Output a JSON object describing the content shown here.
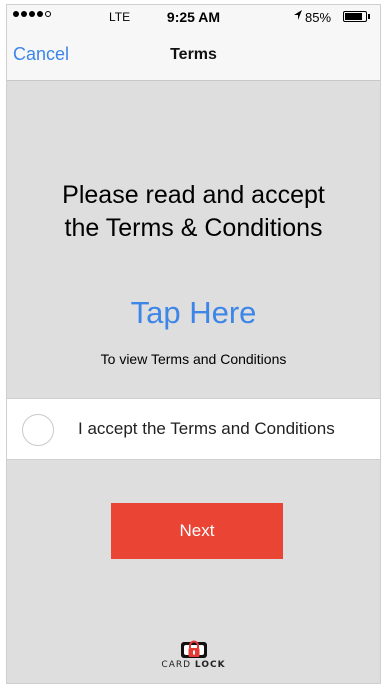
{
  "status_bar": {
    "carrier": "LTE",
    "time": "9:25 AM",
    "battery_percent": "85%",
    "battery_level": 0.85,
    "location_icon": "location-arrow-icon"
  },
  "nav": {
    "cancel_label": "Cancel",
    "title": "Terms"
  },
  "main": {
    "heading_line1": "Please read and accept",
    "heading_line2": "the Terms & Conditions",
    "tap_here": "Tap Here",
    "view_terms": "To view Terms and Conditions",
    "accept_label": "I accept the Terms and Conditions",
    "accept_checked": false,
    "next_label": "Next"
  },
  "logo": {
    "text_light": "CARD",
    "text_bold": "LOCK"
  },
  "colors": {
    "accent": "#3d86e8",
    "button": "#ea4435",
    "background": "#dedede"
  }
}
